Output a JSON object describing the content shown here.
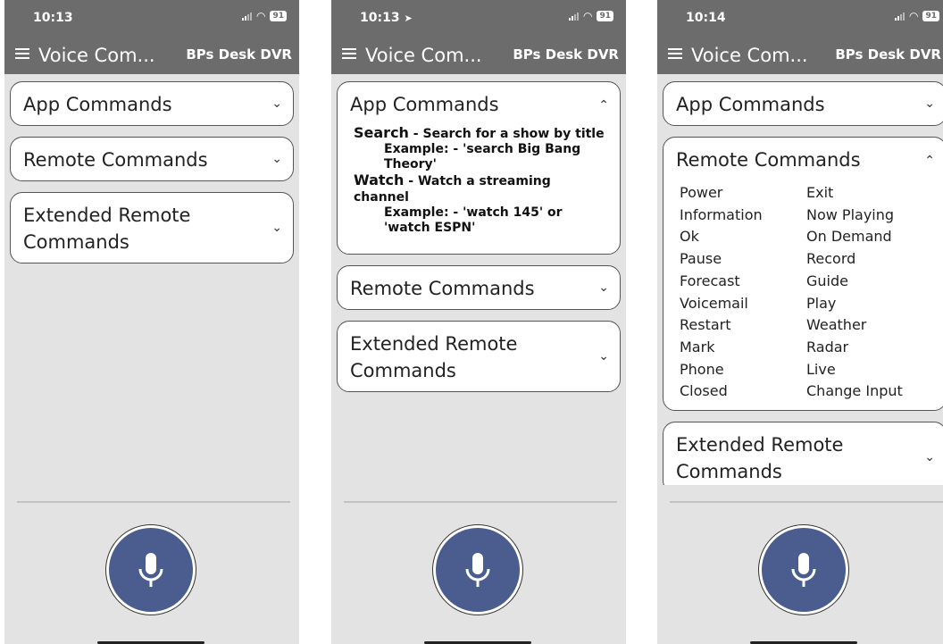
{
  "screens": [
    {
      "status_time": "10:13",
      "location_arrow": "",
      "battery": "91",
      "title": "Voice Com...",
      "device": "BPs Desk DVR",
      "sections": [
        {
          "title": "App Commands",
          "chevron": "⌄"
        },
        {
          "title": "Remote Commands",
          "chevron": "⌄"
        },
        {
          "title": "Extended Remote Commands",
          "chevron": "⌄"
        }
      ]
    },
    {
      "status_time": "10:13",
      "location_arrow": "➤",
      "battery": "91",
      "title": "Voice Com...",
      "device": "BPs Desk DVR",
      "sections": [
        {
          "title": "App Commands",
          "chevron": "⌃"
        },
        {
          "title": "Remote Commands",
          "chevron": "⌄"
        },
        {
          "title": "Extended Remote Commands",
          "chevron": "⌄"
        }
      ],
      "app_commands": [
        {
          "name": "Search",
          "desc": " - Search for a show by title",
          "example_label": "Example:",
          "example": " - 'search Big Bang Theory'"
        },
        {
          "name": "Watch",
          "desc": " - Watch a streaming channel",
          "example_label": "Example:",
          "example": " - 'watch 145' or 'watch ESPN'"
        }
      ]
    },
    {
      "status_time": "10:14",
      "location_arrow": "",
      "battery": "91",
      "title": "Voice Com...",
      "device": "BPs Desk DVR",
      "sections": [
        {
          "title": "App Commands",
          "chevron": "⌄"
        },
        {
          "title": "Remote Commands",
          "chevron": "⌃"
        },
        {
          "title": "Extended Remote Commands",
          "chevron": "⌄"
        }
      ],
      "remote_commands": [
        "Power",
        "Exit",
        "Information",
        "Now Playing",
        "Ok",
        "On Demand",
        "Pause",
        "Record",
        "Forecast",
        "Guide",
        "Voicemail",
        "Play",
        "Restart",
        "Weather",
        "Mark",
        "Radar",
        "Phone",
        "Live",
        "Closed",
        "Change Input"
      ]
    }
  ],
  "colors": {
    "bar": "#6c6c6c",
    "background": "#e3e3e3",
    "mic": "#4a5d8e"
  },
  "icons": {
    "menu": "hamburger-menu-icon",
    "mic": "microphone-icon",
    "wifi": "wifi-icon",
    "signal": "signal-icon",
    "battery": "battery-icon"
  }
}
